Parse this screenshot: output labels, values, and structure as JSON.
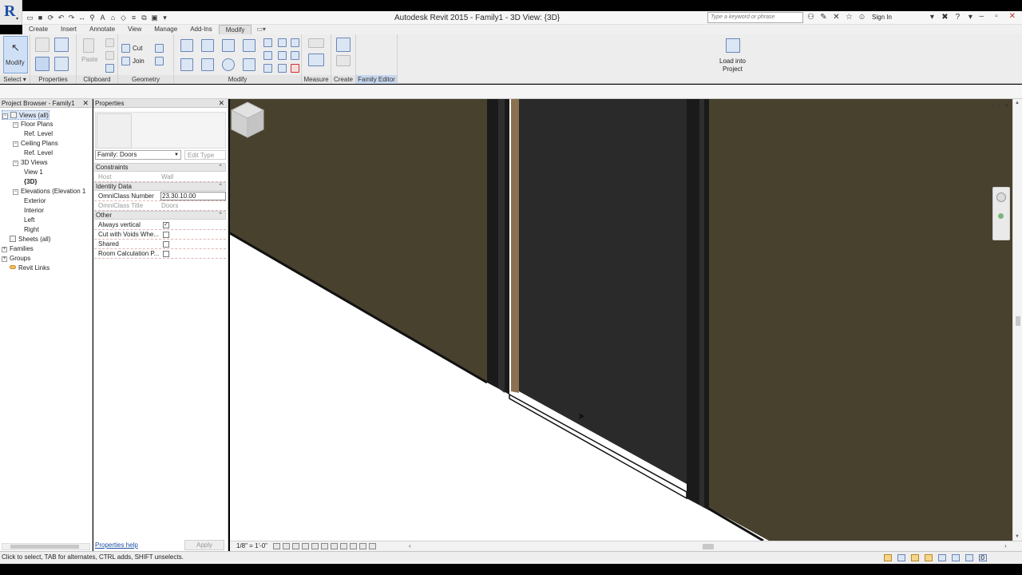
{
  "window": {
    "title": "Autodesk Revit 2015 -    Family1 - 3D View: {3D}",
    "search_placeholder": "Type a keyword or phrase",
    "sign_in": "Sign In",
    "help": "?",
    "controls": [
      "–",
      "▫",
      "✕"
    ]
  },
  "qat": {
    "icons": [
      "open",
      "save",
      "sync",
      "undo",
      "redo",
      "measure",
      "tag",
      "text",
      "3d-view",
      "section",
      "thin-lines",
      "close-windows",
      "switch-windows",
      "customize"
    ]
  },
  "tabs": [
    "Create",
    "Insert",
    "Annotate",
    "View",
    "Manage",
    "Add-Ins",
    "Modify"
  ],
  "active_tab": "Modify",
  "ribbon": {
    "modify": "Modify",
    "paste": "Paste",
    "cut": "Cut",
    "join": "Join",
    "load_line1": "Load into",
    "load_line2": "Project",
    "panels": [
      "Select ▾",
      "Properties",
      "Clipboard",
      "Geometry",
      "Modify",
      "Measure",
      "Create",
      "Family Editor"
    ]
  },
  "project_browser": {
    "title": "Project Browser - Family1",
    "items": [
      {
        "label": "Views (all)",
        "level": 0,
        "exp": "−",
        "icon": true,
        "selected": true
      },
      {
        "label": "Floor Plans",
        "level": 1,
        "exp": "−"
      },
      {
        "label": "Ref. Level",
        "level": 2
      },
      {
        "label": "Ceiling Plans",
        "level": 1,
        "exp": "−"
      },
      {
        "label": "Ref. Level",
        "level": 2
      },
      {
        "label": "3D Views",
        "level": 1,
        "exp": "−"
      },
      {
        "label": "View 1",
        "level": 2
      },
      {
        "label": "{3D}",
        "level": 2,
        "bold": true
      },
      {
        "label": "Elevations (Elevation 1",
        "level": 1,
        "exp": "−"
      },
      {
        "label": "Exterior",
        "level": 2
      },
      {
        "label": "Interior",
        "level": 2
      },
      {
        "label": "Left",
        "level": 2
      },
      {
        "label": "Right",
        "level": 2
      },
      {
        "label": "Sheets (all)",
        "level": 0,
        "icon": true
      },
      {
        "label": "Families",
        "level": 0,
        "exp": "+"
      },
      {
        "label": "Groups",
        "level": 0,
        "exp": "+"
      },
      {
        "label": "Revit Links",
        "level": 0,
        "link": true
      }
    ]
  },
  "properties": {
    "title": "Properties",
    "family_selector": "Family: Doors",
    "edit_type": "Edit Type",
    "groups": {
      "constraints": "Constraints",
      "identity": "Identity Data",
      "other": "Other"
    },
    "rows": {
      "host_k": "Host",
      "host_v": "Wall",
      "omni_num_k": "OmniClass Number",
      "omni_num_v": "23.30.10.00",
      "omni_title_k": "OmniClass Title",
      "omni_title_v": "Doors",
      "always_vertical": "Always vertical",
      "cut_voids": "Cut with Voids Whe...",
      "shared": "Shared",
      "room_calc": "Room Calculation P..."
    },
    "checks": {
      "always_vertical": true,
      "cut_voids": false,
      "shared": false,
      "room_calc": false
    },
    "help_link": "Properties help",
    "apply": "Apply"
  },
  "view_control": {
    "scale": "1/8\" = 1'-0\""
  },
  "status": {
    "text": "Click to select, TAB for alternates, CTRL adds, SHIFT unselects.",
    "filter_count": ":0"
  },
  "colors": {
    "wall": "#48412e",
    "door_panel": "#2a2a2a",
    "frame": "#1a1a1a",
    "jamb_trim": "#8b7150"
  }
}
